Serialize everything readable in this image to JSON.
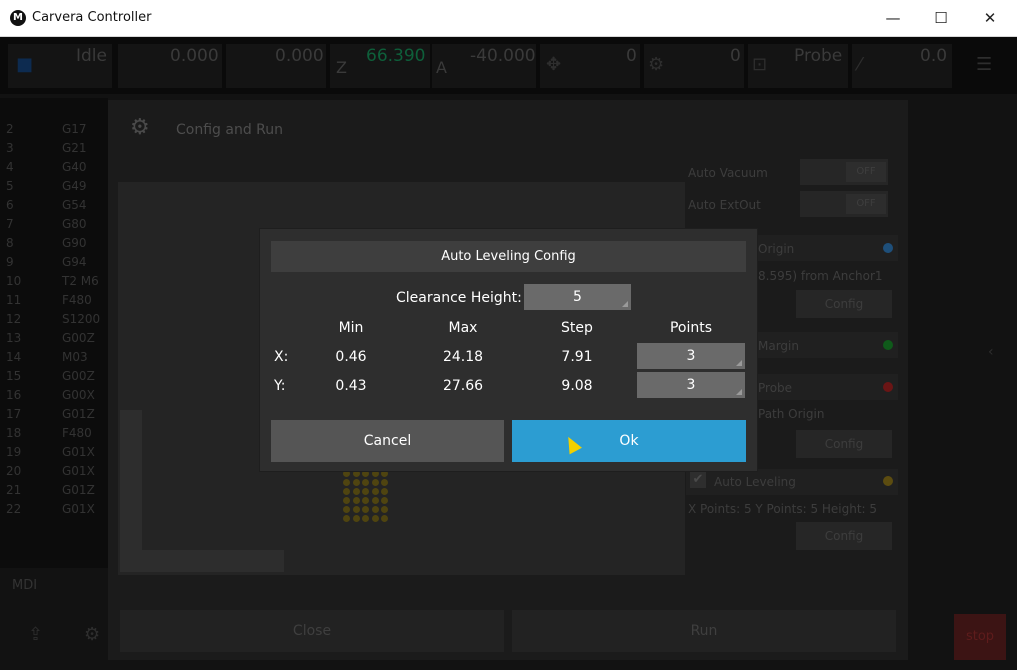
{
  "window": {
    "title": "Carvera Controller",
    "logo": "M",
    "minimize": "—",
    "maximize": "☐",
    "close": "✕"
  },
  "topbar": {
    "state": "Idle",
    "x": "0.000",
    "y": "0.000",
    "z": "66.390",
    "z_letter": "Z",
    "a_letter": "A",
    "a": "-40.000",
    "feed": "0",
    "spindle": "0",
    "probe": "Probe",
    "laser": "0.0",
    "colors": {
      "z": "#0e5f3a"
    }
  },
  "gcode": {
    "lines": [
      {
        "n": "2",
        "c": "G17"
      },
      {
        "n": "3",
        "c": "G21"
      },
      {
        "n": "4",
        "c": "G40"
      },
      {
        "n": "5",
        "c": "G49"
      },
      {
        "n": "6",
        "c": "G54"
      },
      {
        "n": "7",
        "c": "G80"
      },
      {
        "n": "8",
        "c": "G90"
      },
      {
        "n": "9",
        "c": "G94"
      },
      {
        "n": "10",
        "c": "T2 M6"
      },
      {
        "n": "11",
        "c": "F480"
      },
      {
        "n": "12",
        "c": "S1200"
      },
      {
        "n": "13",
        "c": "G00Z"
      },
      {
        "n": "14",
        "c": "M03"
      },
      {
        "n": "15",
        "c": "G00Z"
      },
      {
        "n": "16",
        "c": "G00X"
      },
      {
        "n": "17",
        "c": "G01Z"
      },
      {
        "n": "18",
        "c": "F480"
      },
      {
        "n": "19",
        "c": "G01X"
      },
      {
        "n": "20",
        "c": "G01X"
      },
      {
        "n": "21",
        "c": "G01Z"
      },
      {
        "n": "22",
        "c": "G01X"
      }
    ],
    "mdi": "MDI"
  },
  "config_run": {
    "title": "Config and Run",
    "auto_vacuum": "Auto Vacuum",
    "auto_extout": "Auto ExtOut",
    "off": "OFF",
    "origin_label": "Origin",
    "origin_text": "8.595) from Anchor1",
    "config": "Config",
    "margin_label": "Margin",
    "zprobe_label": "Probe",
    "path_origin_label": "Path Origin",
    "auto_leveling": "Auto Leveling",
    "auto_leveling_text": "X Points: 5 Y Points: 5 Height: 5",
    "close": "Close",
    "run": "Run",
    "stop": "stop",
    "colors": {
      "origin": "#1e4f7a",
      "margin": "#0f5a1a",
      "probe": "#6a1515",
      "leveling": "#5c4c10"
    }
  },
  "dialog": {
    "title": "Auto Leveling Config",
    "clearance_label": "Clearance Height:",
    "clearance_value": "5",
    "headers": {
      "min": "Min",
      "max": "Max",
      "step": "Step",
      "points": "Points"
    },
    "rows": [
      {
        "axis": "X:",
        "min": "0.46",
        "max": "24.18",
        "step": "7.91",
        "points": "3"
      },
      {
        "axis": "Y:",
        "min": "0.43",
        "max": "27.66",
        "step": "9.08",
        "points": "3"
      }
    ],
    "cancel": "Cancel",
    "ok": "Ok",
    "colors": {
      "ok": "#2c9dd2",
      "cancel": "#555555"
    }
  }
}
